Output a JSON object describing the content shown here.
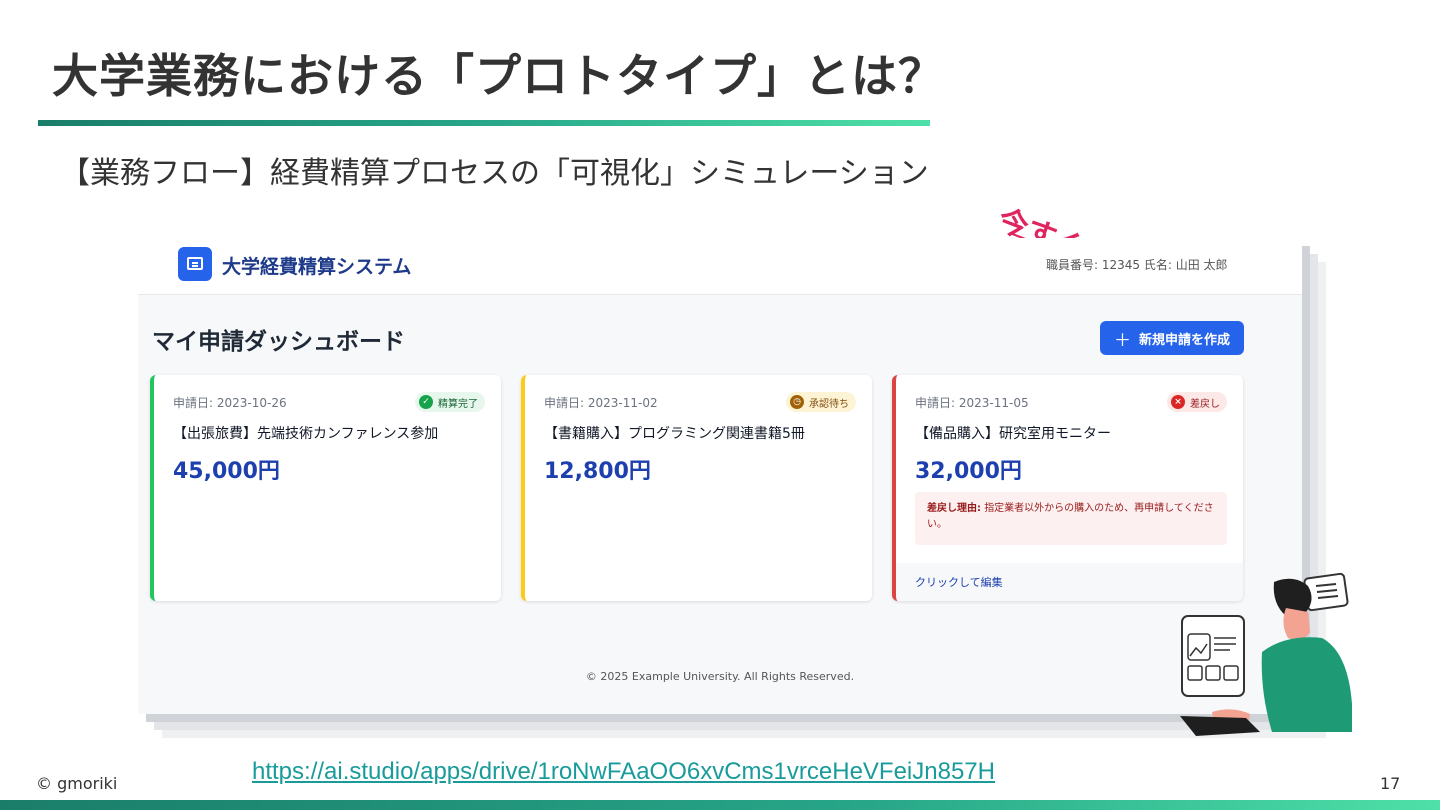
{
  "slide": {
    "title": "大学業務における「プロトタイプ」とは？",
    "subtitle": "【業務フロー】経費精算プロセスの「可視化」シミュレーション",
    "annotation": "今すぐ・誰でも生成可能",
    "copyright": "© gmoriki",
    "url": "https://ai.studio/apps/drive/1roNwFAaOO6xvCms1vrceHeVFeiJn857H",
    "page_number": "17"
  },
  "app": {
    "name": "大学経費精算システム",
    "user_info": "職員番号: 12345 氏名: 山田 太郎",
    "dashboard_title": "マイ申請ダッシュボード",
    "new_button_label": "新規申請を作成",
    "copyright": "© 2025 Example University. All Rights Reserved.",
    "cards": [
      {
        "date": "申請日: 2023-10-26",
        "status": "精算完了",
        "title": "【出張旅費】先端技術カンファレンス参加",
        "amount": "45,000円"
      },
      {
        "date": "申請日: 2023-11-02",
        "status": "承認待ち",
        "title": "【書籍購入】プログラミング関連書籍5冊",
        "amount": "12,800円"
      },
      {
        "date": "申請日: 2023-11-05",
        "status": "差戻し",
        "title": "【備品購入】研究室用モニター",
        "amount": "32,000円",
        "reject_label": "差戻し理由:",
        "reject_reason": "指定業者以外からの購入のため、再申請してください。",
        "edit_link": "クリックして編集"
      }
    ]
  },
  "colors": {
    "accent_gradient_start": "#1a7d6a",
    "accent_gradient_end": "#4ee0a8",
    "annotation": "#e0245e",
    "primary_blue": "#2563eb",
    "status_done": "#22c55e",
    "status_pending": "#facc15",
    "status_rejected": "#dc4444"
  },
  "icons": {
    "logo": "receipt-icon",
    "done": "check-circle-icon",
    "pending": "clock-icon",
    "rejected": "x-circle-icon"
  }
}
